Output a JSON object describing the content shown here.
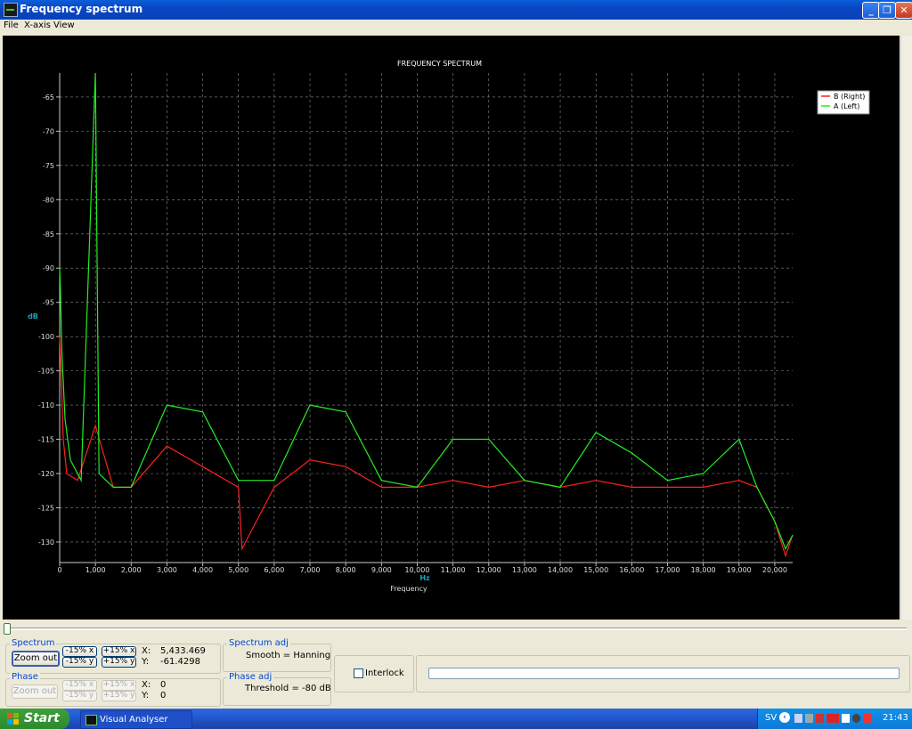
{
  "window": {
    "title": "Frequency spectrum",
    "minimize_symbol": "_",
    "restore_symbol": "❐",
    "close_symbol": "✕"
  },
  "menu": [
    "File",
    "X-axis",
    "View"
  ],
  "chart_data": {
    "type": "line",
    "title": "FREQUENCY SPECTRUM",
    "xlabel": "Frequency",
    "xunit": "Hz",
    "ylabel": "dB",
    "xlim": [
      0,
      20500
    ],
    "ylim": [
      -133,
      -61.5
    ],
    "x_ticks": [
      "0",
      "1,000",
      "2,000",
      "3,000",
      "4,000",
      "5,000",
      "6,000",
      "7,000",
      "8,000",
      "9,000",
      "10,000",
      "11,000",
      "12,000",
      "13,000",
      "14,000",
      "15,000",
      "16,000",
      "17,000",
      "18,000",
      "19,000",
      "20,000"
    ],
    "y_ticks": [
      "-65",
      "-70",
      "-75",
      "-80",
      "-85",
      "-90",
      "-95",
      "-100",
      "-105",
      "-110",
      "-115",
      "-120",
      "-125",
      "-130"
    ],
    "grid": true,
    "legend_position": "top-right",
    "series": [
      {
        "name": "B (Right)",
        "color": "#ff2020",
        "x": [
          0,
          40,
          100,
          200,
          500,
          1000,
          1500,
          2000,
          3000,
          4000,
          5000,
          5100,
          6000,
          7000,
          8000,
          9000,
          10000,
          11000,
          12000,
          13000,
          14000,
          15000,
          16000,
          17000,
          18000,
          19000,
          19500,
          20000,
          20300,
          20500
        ],
        "y": [
          -100,
          -105,
          -115,
          -120,
          -121,
          -113,
          -122,
          -122,
          -116,
          -119,
          -122,
          -131,
          -122,
          -118,
          -119,
          -122,
          -122,
          -121,
          -122,
          -121,
          -122,
          -121,
          -122,
          -122,
          -122,
          -121,
          -122,
          -127,
          -132,
          -129
        ]
      },
      {
        "name": "A (Left)",
        "color": "#22ee22",
        "x": [
          0,
          20,
          60,
          150,
          300,
          600,
          1000,
          1100,
          1500,
          2000,
          3000,
          4000,
          5000,
          6000,
          7000,
          8000,
          9000,
          10000,
          11000,
          12000,
          13000,
          14000,
          15000,
          16000,
          17000,
          18000,
          19000,
          19500,
          20000,
          20300,
          20500
        ],
        "y": [
          -90,
          -93,
          -102,
          -112,
          -118,
          -121,
          -61.5,
          -120,
          -122,
          -122,
          -110,
          -111,
          -121,
          -121,
          -110,
          -111,
          -121,
          -122,
          -115,
          -115,
          -121,
          -122,
          -114,
          -117,
          -121,
          -120,
          -115,
          -122,
          -127,
          -131,
          -129
        ]
      }
    ]
  },
  "spectrum": {
    "label": "Spectrum",
    "zoom_out": "Zoom out",
    "minus_x": "-15% x",
    "plus_x": "+15% x",
    "minus_y": "-15% y",
    "plus_y": "+15% y",
    "x_label": "X:",
    "x_value": "5,433.469",
    "y_label": "Y:",
    "y_value": "-61.4298"
  },
  "phase": {
    "label": "Phase",
    "zoom_out": "Zoom out",
    "minus_x": "-15% x",
    "plus_x": "+15% x",
    "minus_y": "-15% y",
    "plus_y": "+15% y",
    "x_label": "X:",
    "x_value": "0",
    "y_label": "Y:",
    "y_value": "0"
  },
  "spectrum_adj": {
    "label": "Spectrum adj",
    "smooth": "Smooth = Hanning"
  },
  "phase_adj": {
    "label": "Phase adj",
    "threshold": "Threshold = -80 dB"
  },
  "interlock": {
    "label": "Interlock",
    "checked": false
  },
  "taskbar": {
    "start": "Start",
    "task": "Visual Analyser",
    "language": "SV",
    "clock": "21:43"
  }
}
